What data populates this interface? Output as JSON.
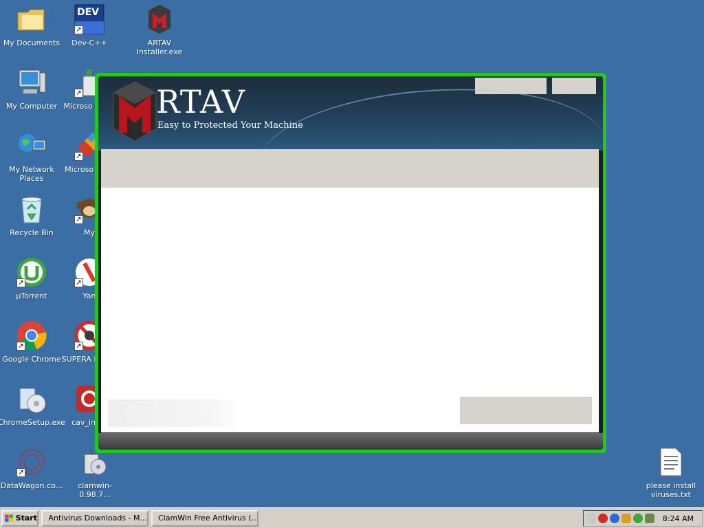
{
  "desktop_icons": [
    {
      "label": "My Documents",
      "icon": "folder-icon"
    },
    {
      "label": "Dev-C++",
      "icon": "devcpp-icon",
      "badge": "DEV"
    },
    {
      "label": "ARTAV Installer.exe",
      "icon": "artav-icon"
    },
    {
      "label": "My Computer",
      "icon": "computer-icon"
    },
    {
      "label": "Microso Basic",
      "icon": "microsoft-basic-icon"
    },
    {
      "label": "My Network Places",
      "icon": "network-icon"
    },
    {
      "label": "Microso C++",
      "icon": "microsoft-cpp-icon"
    },
    {
      "label": "Recycle Bin",
      "icon": "recycle-bin-icon"
    },
    {
      "label": "My",
      "icon": "monkey-icon"
    },
    {
      "label": "µTorrent",
      "icon": "utorrent-icon"
    },
    {
      "label": "Yan",
      "icon": "yandex-icon"
    },
    {
      "label": "Google Chrome",
      "icon": "chrome-icon"
    },
    {
      "label": "SUPERA Free E",
      "icon": "superantispyware-icon"
    },
    {
      "label": "ChromeSetup.exe",
      "icon": "installer-icon"
    },
    {
      "label": "cav_insta",
      "icon": "comodo-icon"
    },
    {
      "label": "DataWagon.co...",
      "icon": "datawagon-icon"
    },
    {
      "label": "clamwin-0.98.7...",
      "icon": "clamwin-icon"
    },
    {
      "label": "please install viruses.txt",
      "icon": "text-file-icon"
    }
  ],
  "artav": {
    "title": "RTAV",
    "subtitle": "Easy to Protected Your Machine",
    "colors": {
      "frame": "#22c722",
      "header": "#22405a",
      "panel": "#ffffff",
      "band": "#d6d3cc"
    }
  },
  "taskbar": {
    "start_label": "Start",
    "tasks": [
      {
        "label": "Antivirus Downloads - M..."
      },
      {
        "label": "ClamWin Free Antivirus (..."
      }
    ],
    "clock": "8:24 AM"
  }
}
